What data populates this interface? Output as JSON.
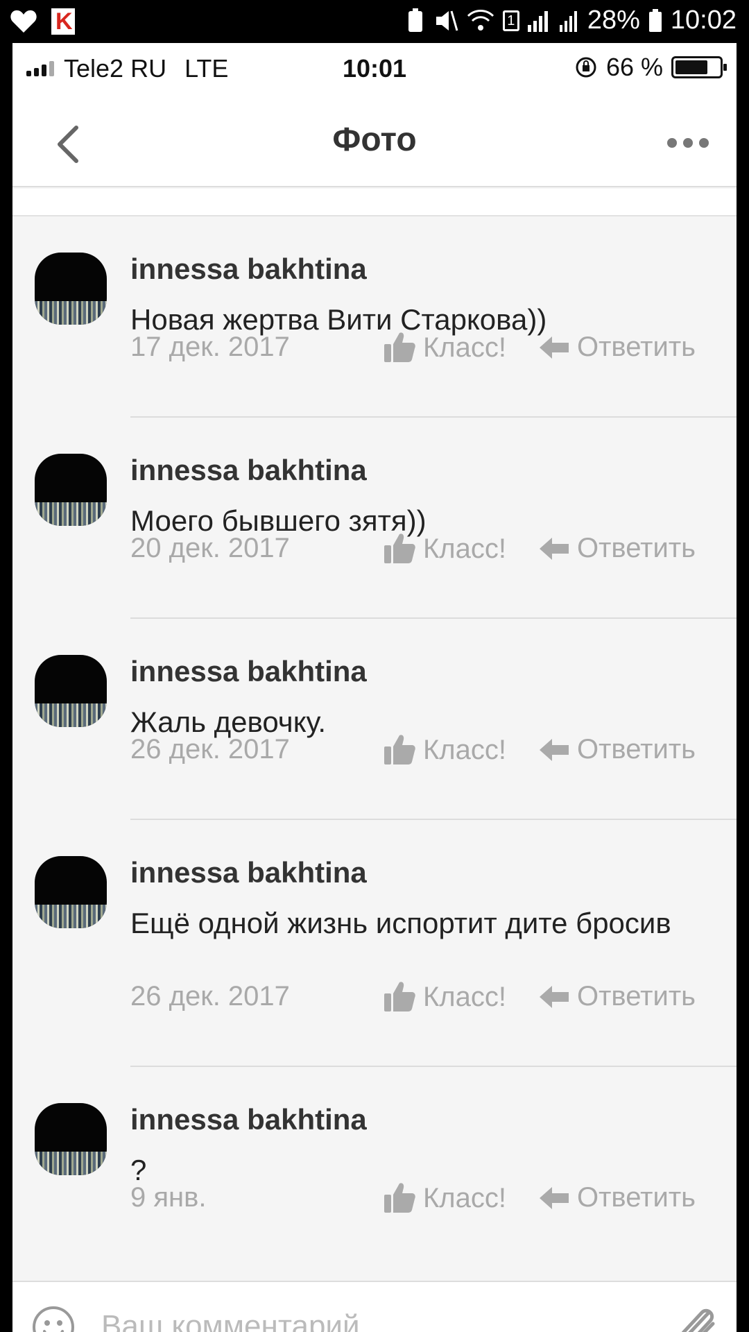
{
  "android_status": {
    "battery": "28%",
    "time": "10:02",
    "sim": "1"
  },
  "ios_status": {
    "carrier": "Tele2 RU",
    "network": "LTE",
    "time": "10:01",
    "battery": "66 %"
  },
  "nav": {
    "title": "Фото"
  },
  "comments": [
    {
      "author": "innessa bakhtina",
      "text": "Новая жертва Вити Старкова))",
      "date": "17 дек. 2017",
      "like": "Класс!",
      "reply": "Ответить"
    },
    {
      "author": "innessa bakhtina",
      "text": "Моего бывшего зятя))",
      "date": "20 дек. 2017",
      "like": "Класс!",
      "reply": "Ответить"
    },
    {
      "author": "innessa bakhtina",
      "text": "Жаль девочку.",
      "date": "26 дек. 2017",
      "like": "Класс!",
      "reply": "Ответить"
    },
    {
      "author": "innessa bakhtina",
      "text": "Ещё одной жизнь испортит дите бросив",
      "date": "26 дек. 2017",
      "like": "Класс!",
      "reply": "Ответить"
    },
    {
      "author": "innessa bakhtina",
      "text": "?",
      "date": "9 янв.",
      "like": "Класс!",
      "reply": "Ответить"
    }
  ],
  "composer": {
    "placeholder": "Ваш комментарий"
  }
}
